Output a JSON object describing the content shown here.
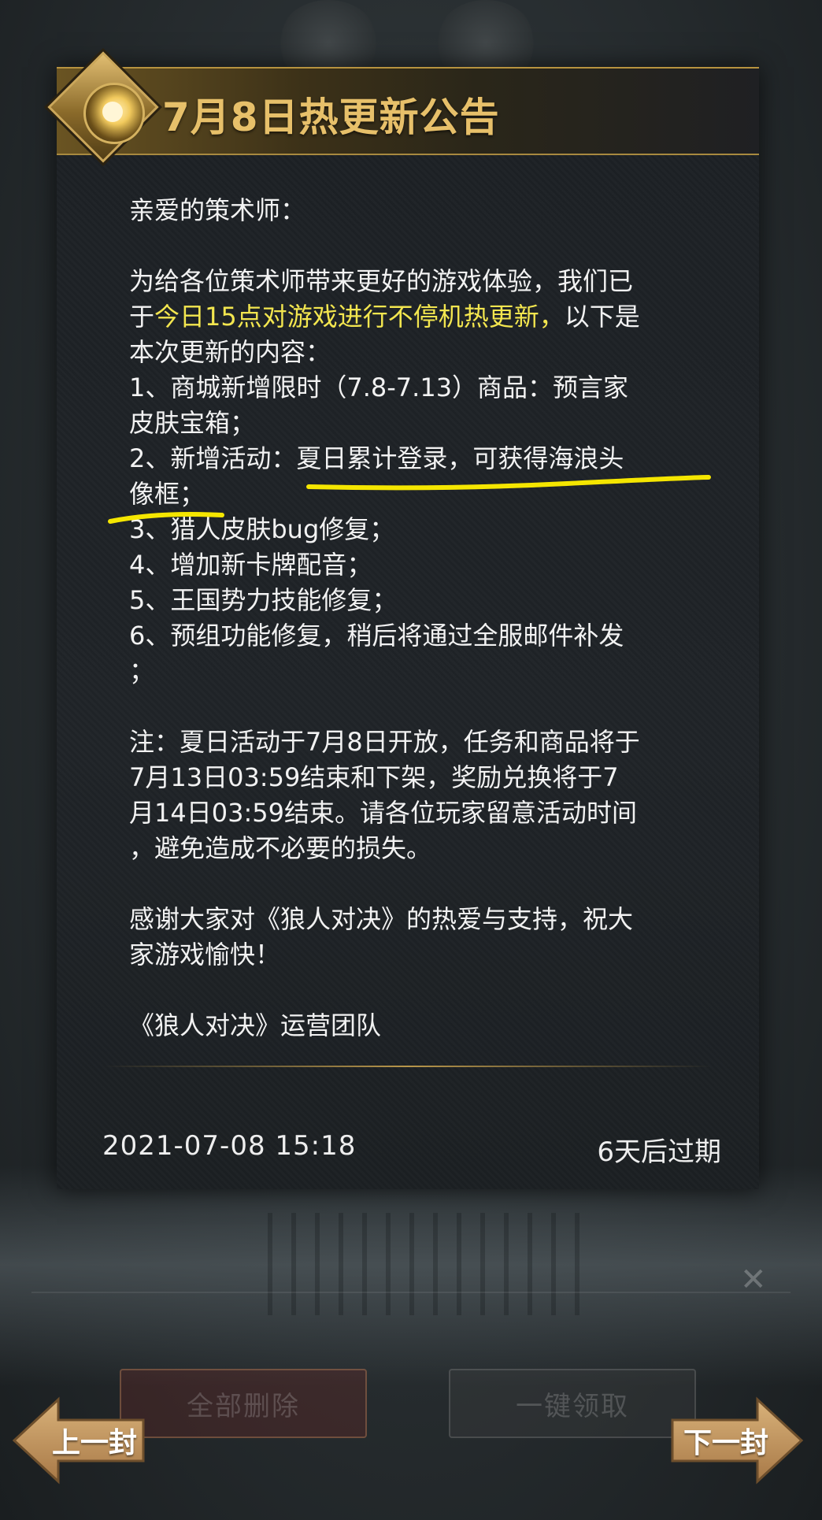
{
  "background": {
    "delete_all_label": "全部删除",
    "claim_all_label": "一键领取"
  },
  "dialog": {
    "title": "7月8日热更新公告",
    "greeting": "亲爱的策术师：",
    "intro_a": "为给各位策术师带来更好的游戏体验，我们已",
    "intro_b_prefix": "于",
    "intro_b_highlight": "今日15点对游戏进行不停机热更新，",
    "intro_b_suffix": "以下是",
    "intro_c": "本次更新的内容：",
    "item1_a": "1、商城新增限时（7.8-7.13）商品：预言家",
    "item1_b": "皮肤宝箱；",
    "item2_a": "2、新增活动：夏日累计登录，可获得海浪头",
    "item2_b": "像框；",
    "item3": "3、猎人皮肤bug修复；",
    "item4": "4、增加新卡牌配音；",
    "item5": "5、王国势力技能修复；",
    "item6_a": "6、预组功能修复，稍后将通过全服邮件补发",
    "item6_b": "；",
    "note_a": "注：夏日活动于7月8日开放，任务和商品将于",
    "note_b": "7月13日03:59结束和下架，奖励兑换将于7",
    "note_c": "月14日03:59结束。请各位玩家留意活动时间",
    "note_d": "，避免造成不必要的损失。",
    "thanks_a": "感谢大家对《狼人对决》的热爱与支持，祝大",
    "thanks_b": "家游戏愉快！",
    "signature": "《狼人对决》运营团队",
    "date": "2021-07-08  15:18",
    "expire": "6天后过期",
    "highlight_color": "#f3e64f",
    "accent_color": "#e7c06a"
  },
  "nav": {
    "prev_label": "上一封",
    "next_label": "下一封"
  },
  "annotation_color": "#f5e600"
}
